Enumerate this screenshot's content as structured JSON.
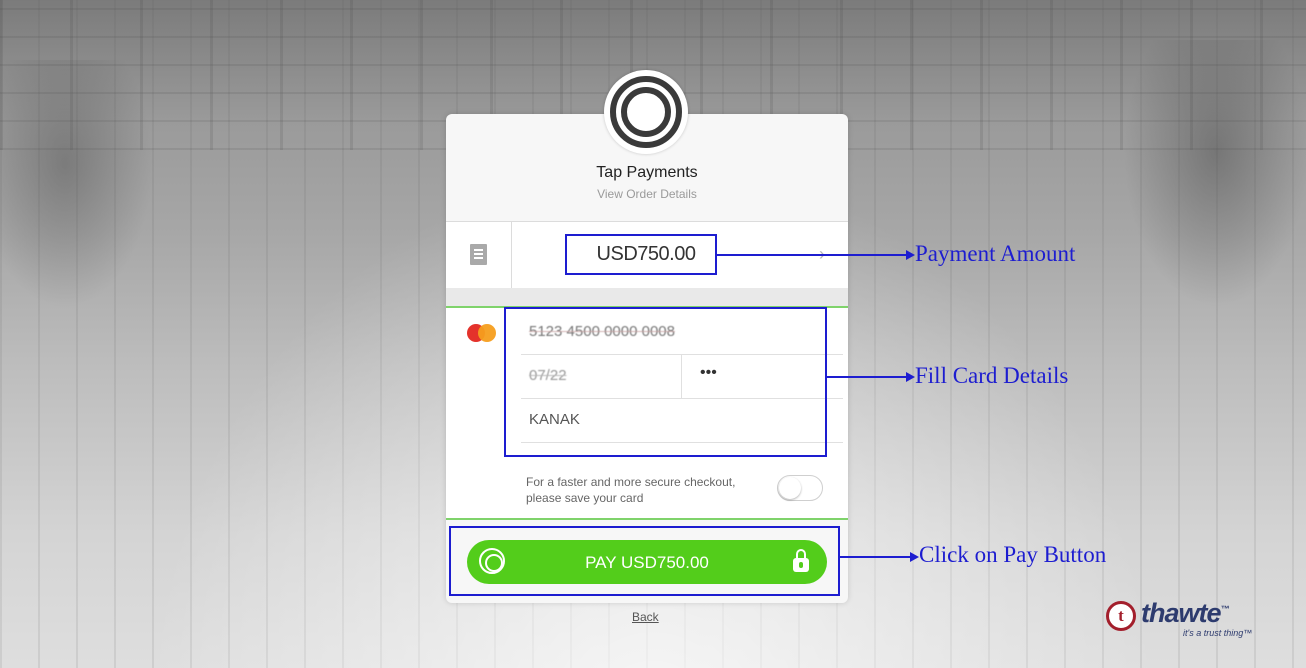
{
  "merchant": {
    "name": "Tap Payments",
    "order_details_link": "View Order Details"
  },
  "amount": {
    "display": "USD750.00",
    "receipt_icon": "receipt-icon",
    "expand_icon": "chevron-right-icon"
  },
  "card_form": {
    "brand_icon": "mastercard-icon",
    "card_number": "5123 4500 0000 0008",
    "expiry": "07/22",
    "cvv_masked": "•••",
    "cardholder": "KANAK",
    "save_card_text": "For a faster and more secure checkout, please save your card",
    "save_card_enabled": false
  },
  "pay_button": {
    "label": "PAY USD750.00",
    "logo_icon": "tap-logo-icon",
    "lock_icon": "lock-icon",
    "color": "#53cd1b"
  },
  "back_link": "Back",
  "annotations": {
    "payment_amount": "Payment Amount",
    "fill_card_details": "Fill Card Details",
    "click_pay": "Click on Pay Button",
    "color": "#1d1dd0"
  },
  "trust_badge": {
    "brand": "thawte",
    "trademark": "™",
    "tagline": "it's a trust thing™",
    "badge_letter": "t"
  }
}
